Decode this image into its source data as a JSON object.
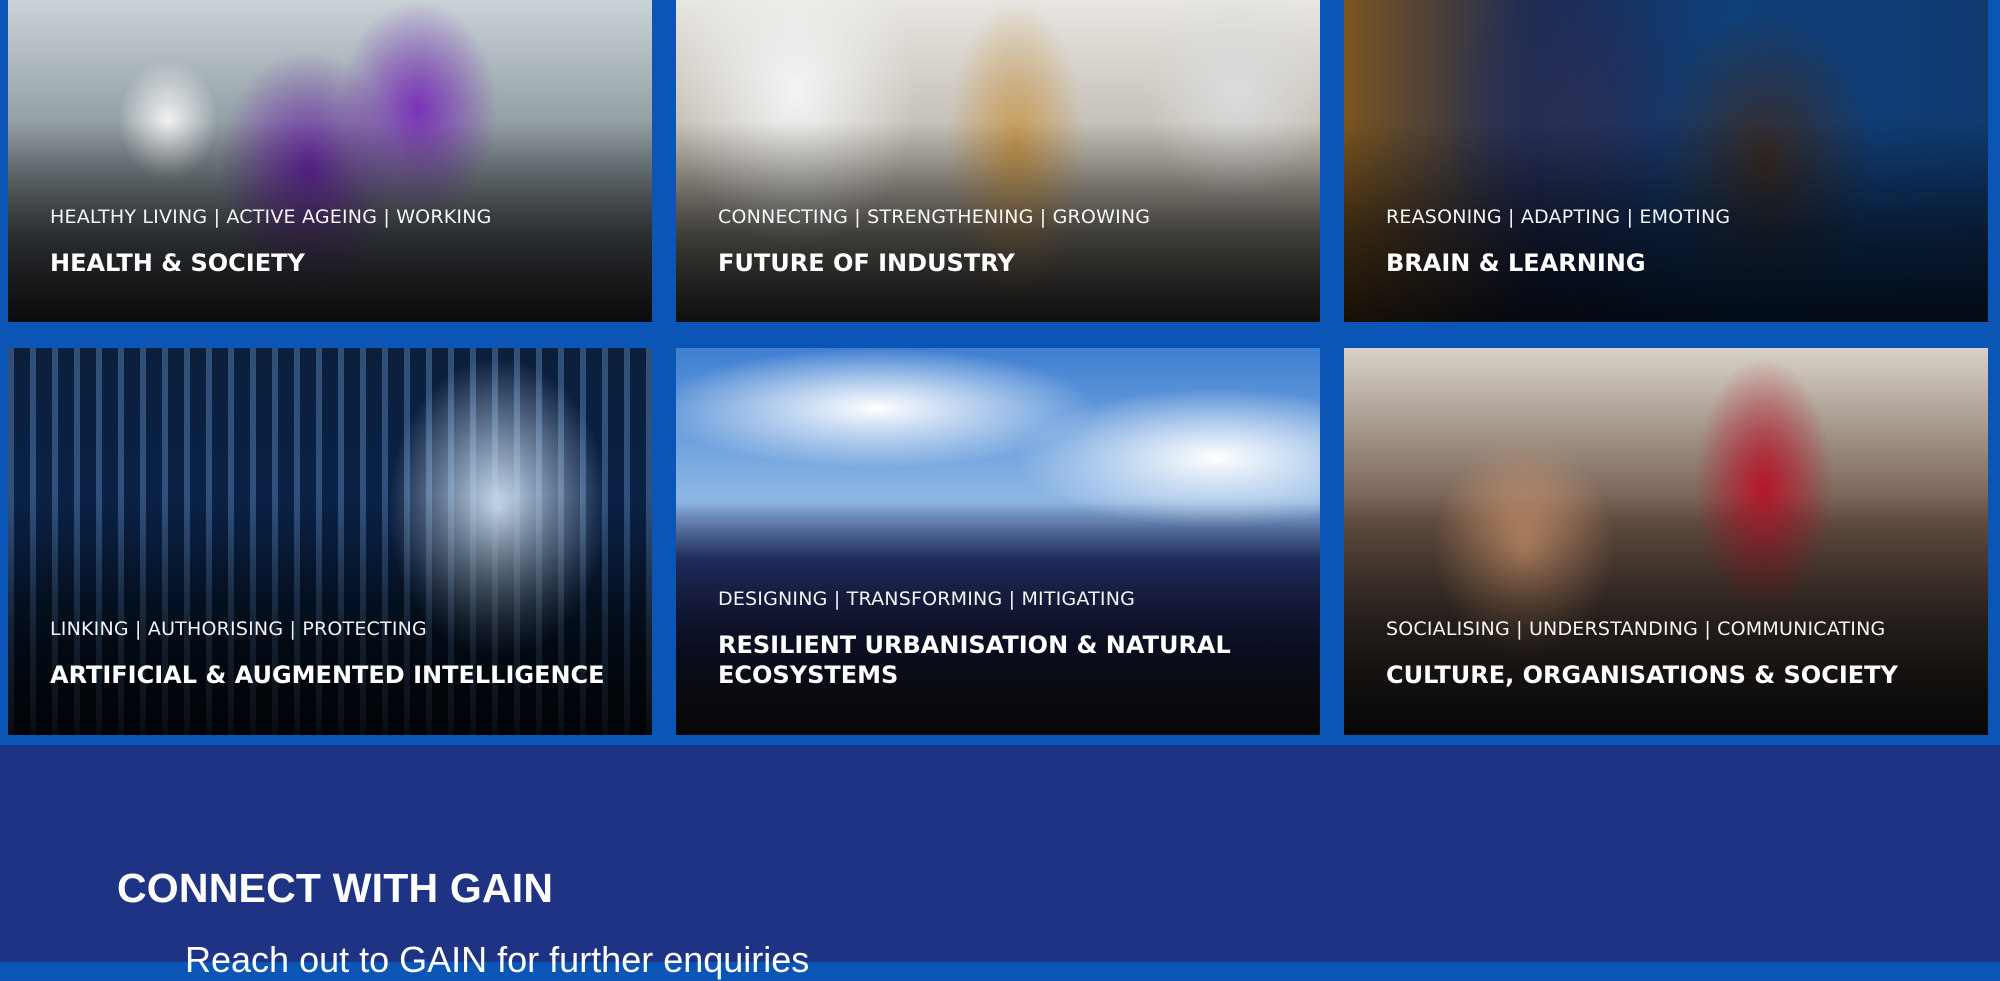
{
  "colors": {
    "grid_background": "#0a55b5",
    "footer_background": "#1f3384",
    "text": "#ffffff"
  },
  "tiles": [
    {
      "subtitle": "HEALTHY LIVING | ACTIVE AGEING | WORKING",
      "title": "HEALTH & SOCIETY"
    },
    {
      "subtitle": "CONNECTING | STRENGTHENING | GROWING",
      "title": "FUTURE OF INDUSTRY"
    },
    {
      "subtitle": "REASONING | ADAPTING | EMOTING",
      "title": "BRAIN & LEARNING"
    },
    {
      "subtitle": "LINKING | AUTHORISING | PROTECTING",
      "title": "ARTIFICIAL & AUGMENTED INTELLIGENCE"
    },
    {
      "subtitle": "DESIGNING | TRANSFORMING | MITIGATING",
      "title": "RESILIENT URBANISATION & NATURAL ECOSYSTEMS"
    },
    {
      "subtitle": "SOCIALISING | UNDERSTANDING | COMMUNICATING",
      "title": "CULTURE, ORGANISATIONS & SOCIETY"
    }
  ],
  "connect": {
    "heading": "CONNECT WITH GAIN",
    "text": "Reach out to GAIN for further enquiries"
  }
}
